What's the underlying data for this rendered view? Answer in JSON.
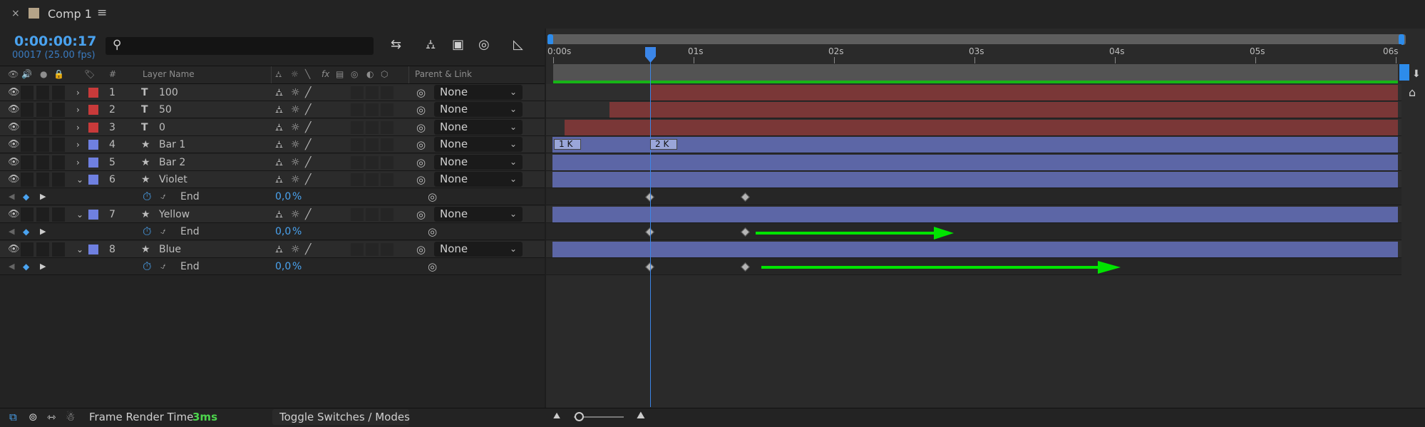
{
  "tab": {
    "close": "×",
    "title": "Comp 1",
    "menu": "≡"
  },
  "timecode": "0:00:00:17",
  "fps_line": "00017 (25.00 fps)",
  "search": {
    "placeholder": ""
  },
  "columns": {
    "number": "#",
    "layer_name": "Layer Name",
    "fx": "fx",
    "parent_link": "Parent & Link"
  },
  "layers": [
    {
      "num": "1",
      "type": "T",
      "name": "100",
      "label_color": "#c83a3a",
      "parent": "None"
    },
    {
      "num": "2",
      "type": "T",
      "name": "50",
      "label_color": "#c83a3a",
      "parent": "None"
    },
    {
      "num": "3",
      "type": "T",
      "name": "0",
      "label_color": "#c83a3a",
      "parent": "None"
    },
    {
      "num": "4",
      "type": "★",
      "name": "Bar 1",
      "label_color": "#6f80e0",
      "parent": "None"
    },
    {
      "num": "5",
      "type": "★",
      "name": "Bar 2",
      "label_color": "#6f80e0",
      "parent": "None"
    },
    {
      "num": "6",
      "type": "★",
      "name": "Violet",
      "label_color": "#6f80e0",
      "parent": "None"
    },
    {
      "num": "7",
      "type": "★",
      "name": "Yellow",
      "label_color": "#6f80e0",
      "parent": "None"
    },
    {
      "num": "8",
      "type": "★",
      "name": "Blue",
      "label_color": "#6f80e0",
      "parent": "None"
    }
  ],
  "property": {
    "name": "End",
    "value": "0,0",
    "unit": "%"
  },
  "ruler": [
    "0:00s",
    "01s",
    "02s",
    "03s",
    "04s",
    "05s",
    "06s"
  ],
  "markers": [
    "1 K",
    "2 K"
  ],
  "bottom": {
    "frame_render_label": "Frame Render Time",
    "frame_render_value": "3ms",
    "toggle": "Toggle Switches / Modes"
  },
  "colors": {
    "accent": "#2d8ceb",
    "text_layer_bar": "#7a3737",
    "shape_layer_bar": "#5c66a6",
    "annotation_arrow": "#00e400"
  }
}
